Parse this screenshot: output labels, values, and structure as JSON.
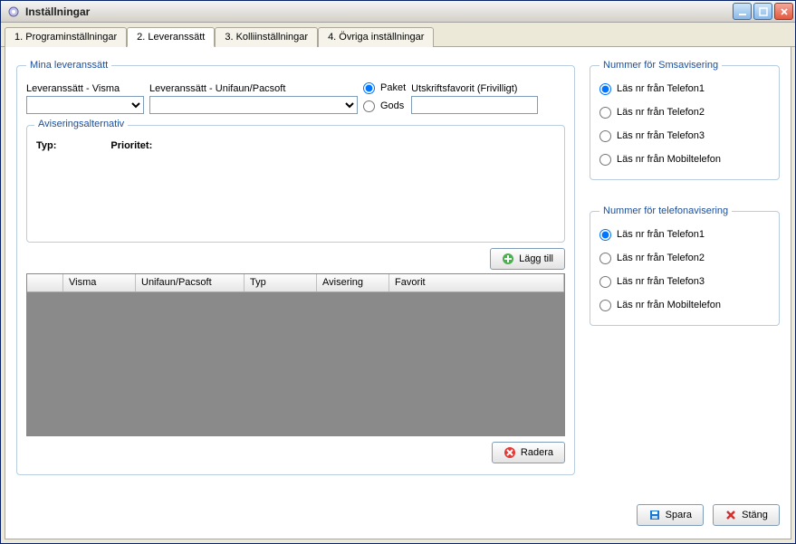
{
  "window": {
    "title": "Inställningar"
  },
  "tabs": [
    {
      "label": "1. Programinställningar"
    },
    {
      "label": "2. Leveranssätt"
    },
    {
      "label": "3. Kolliinställningar"
    },
    {
      "label": "4. Övriga inställningar"
    }
  ],
  "activeTab": 1,
  "leverans": {
    "legend": "Mina leveranssätt",
    "vismaLabel": "Leveranssätt - Visma",
    "vismaValue": "",
    "unifaunLabel": "Leveranssätt - Unifaun/Pacsoft",
    "unifaunValue": "",
    "paketLabel": "Paket",
    "godsLabel": "Gods",
    "shipType": "paket",
    "favoritLabel": "Utskriftsfavorit (Frivilligt)",
    "favoritValue": ""
  },
  "avisering": {
    "legend": "Aviseringsalternativ",
    "typLabel": "Typ:",
    "prioritetLabel": "Prioritet:"
  },
  "buttons": {
    "add": "Lägg till",
    "delete": "Radera",
    "save": "Spara",
    "close": "Stäng"
  },
  "grid": {
    "columns": [
      "",
      "Visma",
      "Unifaun/Pacsoft",
      "Typ",
      "Avisering",
      "Favorit"
    ],
    "rows": []
  },
  "sms": {
    "legend": "Nummer för Smsavisering",
    "options": [
      "Läs nr från Telefon1",
      "Läs nr från Telefon2",
      "Läs nr från Telefon3",
      "Läs nr från Mobiltelefon"
    ],
    "selected": 0
  },
  "tel": {
    "legend": "Nummer för telefonavisering",
    "options": [
      "Läs nr från Telefon1",
      "Läs nr från Telefon2",
      "Läs nr från Telefon3",
      "Läs nr från Mobiltelefon"
    ],
    "selected": 0
  }
}
